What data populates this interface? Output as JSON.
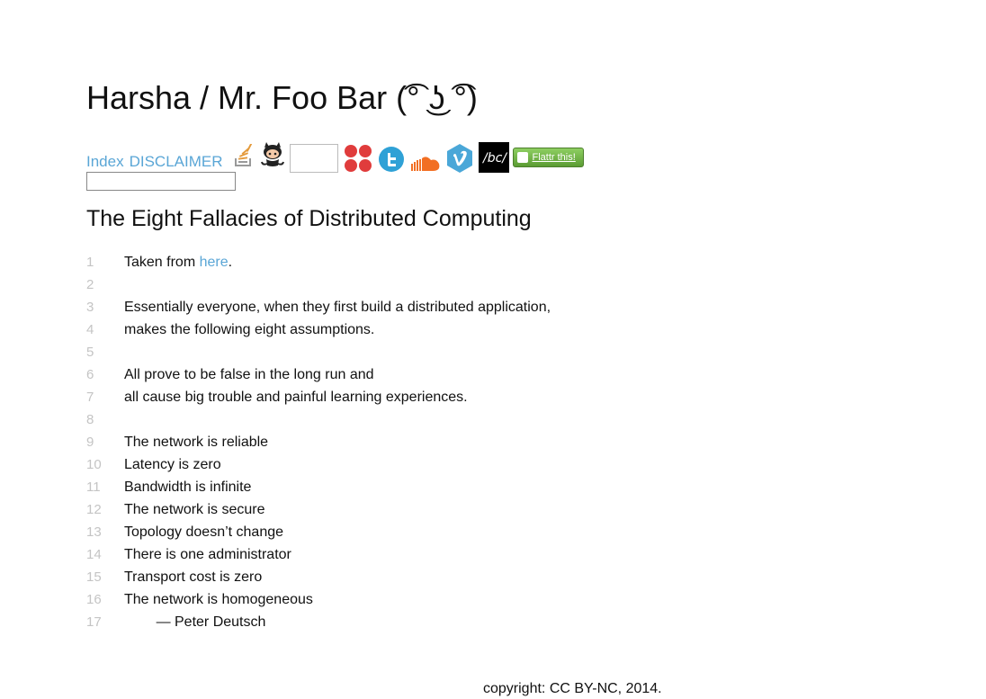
{
  "site": {
    "title": "Harsha / Mr. Foo Bar (͡° ͜ʖ ͡°)"
  },
  "nav": {
    "index_label": "Index",
    "disclaimer_label": "DISCLAIMER",
    "icons": [
      "stackoverflow-icon",
      "github-octocat-icon",
      "blank-badge-icon",
      "dots-grid-icon",
      "twitter-icon",
      "soundcloud-icon",
      "vimeo-icon",
      "bandcamp-icon"
    ],
    "flattr_label": "Flattr this!"
  },
  "search": {
    "placeholder": "",
    "value": ""
  },
  "post": {
    "title": "The Eight Fallacies of Distributed Computing",
    "lines": [
      {
        "no": "1",
        "pre": "Taken from ",
        "link": "here",
        "post": "."
      },
      {
        "no": "2",
        "pre": "",
        "link": "",
        "post": ""
      },
      {
        "no": "3",
        "pre": "Essentially everyone, when they first build a distributed application,",
        "link": "",
        "post": ""
      },
      {
        "no": "4",
        "pre": "makes the following eight assumptions.",
        "link": "",
        "post": ""
      },
      {
        "no": "5",
        "pre": "",
        "link": "",
        "post": ""
      },
      {
        "no": "6",
        "pre": "All prove to be false in the long run and",
        "link": "",
        "post": ""
      },
      {
        "no": "7",
        "pre": "all cause big trouble and painful learning experiences.",
        "link": "",
        "post": ""
      },
      {
        "no": "8",
        "pre": "",
        "link": "",
        "post": ""
      },
      {
        "no": "9",
        "pre": "The network is reliable",
        "link": "",
        "post": ""
      },
      {
        "no": "10",
        "pre": "Latency is zero",
        "link": "",
        "post": ""
      },
      {
        "no": "11",
        "pre": "Bandwidth is infinite",
        "link": "",
        "post": ""
      },
      {
        "no": "12",
        "pre": "The network is secure",
        "link": "",
        "post": ""
      },
      {
        "no": "13",
        "pre": "Topology doesn’t change",
        "link": "",
        "post": ""
      },
      {
        "no": "14",
        "pre": "There is one administrator",
        "link": "",
        "post": ""
      },
      {
        "no": "15",
        "pre": "Transport cost is zero",
        "link": "",
        "post": ""
      },
      {
        "no": "16",
        "pre": "The network is homogeneous",
        "link": "",
        "post": ""
      },
      {
        "no": "17",
        "pre": "        — Peter Deutsch",
        "link": "",
        "post": ""
      }
    ]
  },
  "footer": {
    "text": "copyright: CC BY-NC, 2014."
  },
  "colors": {
    "link": "#5aa6d6",
    "lineno": "#c4c4c4",
    "text": "#111111"
  }
}
